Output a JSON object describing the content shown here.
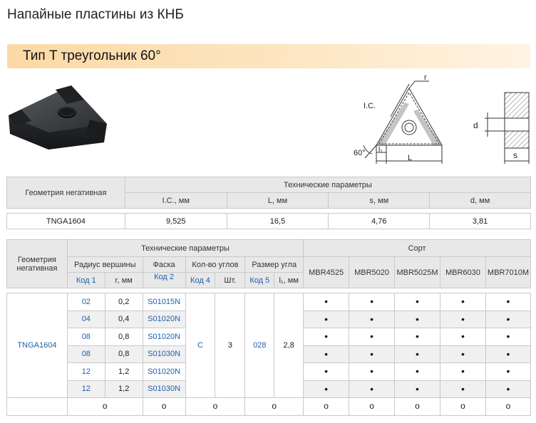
{
  "page_title": "Напайные пластины из КНБ",
  "section_title": "Тип T треугольник 60°",
  "drawing": {
    "r_label": "r",
    "ic_label": "I.C.",
    "angle_label": "60°",
    "l1_label": "l₁",
    "l_label": "L",
    "d_label": "d",
    "s_label": "s"
  },
  "params_table": {
    "geometry_header": "Геометрия негативная",
    "tech_header": "Технические параметры",
    "columns": [
      "I.C., мм",
      "L, мм",
      "s, мм",
      "d, мм"
    ],
    "row": {
      "name": "TNGA1604",
      "values": [
        "9,525",
        "16,5",
        "4,76",
        "3,81"
      ]
    }
  },
  "grades_table": {
    "geometry_header": "Геометрия негативная",
    "tech_header": "Технические параметры",
    "sort_header": "Сорт",
    "radius_header": "Радиус вершины",
    "chamfer_header": "Фаска",
    "corners_header": "Кол-во углов",
    "size_header": "Размер угла",
    "code1": "Код 1",
    "r_mm": "r, мм",
    "code2": "Код 2",
    "code4": "Код 4",
    "pcs": "Шт.",
    "code5": "Код 5",
    "l1_mm": "l₁, мм",
    "grades": [
      "MBR4525",
      "MBR5020",
      "MBR5025M",
      "MBR6030",
      "MBR7010M"
    ],
    "name": "TNGA1604",
    "corners_code": "C",
    "corners_count": "3",
    "size_code": "028",
    "l1_value": "2,8",
    "rows": [
      {
        "code1": "02",
        "r": "0,2",
        "chamfer": "S01015N"
      },
      {
        "code1": "04",
        "r": "0,4",
        "chamfer": "S01020N"
      },
      {
        "code1": "08",
        "r": "0,8",
        "chamfer": "S01020N"
      },
      {
        "code1": "08",
        "r": "0,8",
        "chamfer": "S01030N"
      },
      {
        "code1": "12",
        "r": "1,2",
        "chamfer": "S01020N"
      },
      {
        "code1": "12",
        "r": "1,2",
        "chamfer": "S01030N"
      }
    ],
    "dot_symbol": "•",
    "ring_symbol": "o"
  }
}
